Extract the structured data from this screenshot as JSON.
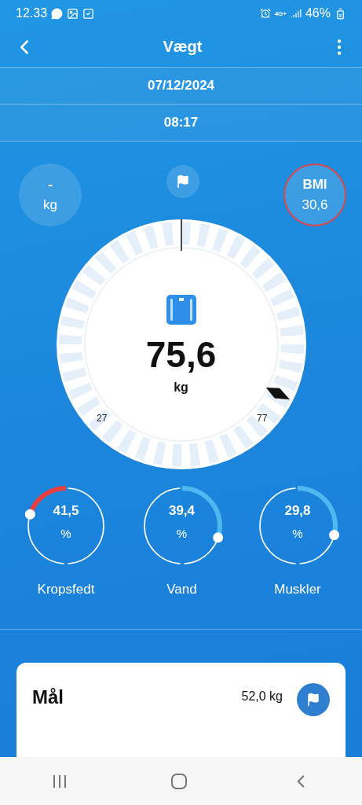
{
  "status_bar": {
    "time": "12.33",
    "network": "4G+",
    "battery": "46%"
  },
  "app_bar": {
    "title": "Vægt"
  },
  "date": "07/12/2024",
  "time": "08:17",
  "target": {
    "value": "-",
    "unit": "kg"
  },
  "bmi": {
    "label": "BMI",
    "value": "30,6"
  },
  "gauge": {
    "value": "75,6",
    "unit": "kg",
    "min_label": "27",
    "max_label": "77"
  },
  "metrics": [
    {
      "value": "41,5",
      "unit": "%",
      "label": "Kropsfedt",
      "color": "#e8403f"
    },
    {
      "value": "39,4",
      "unit": "%",
      "label": "Vand",
      "color": "#4fb8f0"
    },
    {
      "value": "29,8",
      "unit": "%",
      "label": "Muskler",
      "color": "#4fb8f0"
    }
  ],
  "goal": {
    "label": "Mål",
    "value": "52,0 kg"
  }
}
